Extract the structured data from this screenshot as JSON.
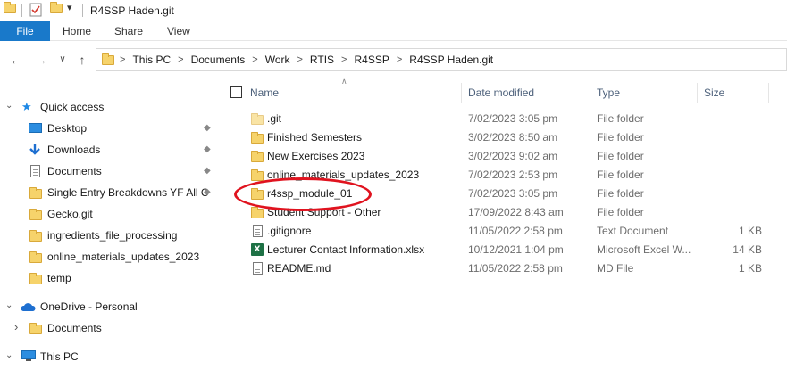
{
  "window": {
    "title": "R4SSP Haden.git"
  },
  "ribbon": {
    "tabs": [
      "File",
      "Home",
      "Share",
      "View"
    ]
  },
  "address": {
    "crumbs": [
      "This PC",
      "Documents",
      "Work",
      "RTIS",
      "R4SSP",
      "R4SSP Haden.git"
    ],
    "separator": ">"
  },
  "nav_glyphs": {
    "back": "←",
    "forward": "→",
    "recent": "∨",
    "up": "↑",
    "expand": "⌄",
    "collapsed": "›",
    "pin": "📌"
  },
  "sidebar": {
    "quick_access": "Quick access",
    "items": [
      {
        "label": "Desktop",
        "icon": "desktop-icon",
        "pinned": true
      },
      {
        "label": "Downloads",
        "icon": "downloads-icon",
        "pinned": true
      },
      {
        "label": "Documents",
        "icon": "documents-icon",
        "pinned": true
      },
      {
        "label": "Single Entry Breakdowns YF All C",
        "icon": "folder-icon",
        "pinned": true
      },
      {
        "label": "Gecko.git",
        "icon": "folder-icon",
        "pinned": false
      },
      {
        "label": "ingredients_file_processing",
        "icon": "folder-icon",
        "pinned": false
      },
      {
        "label": "online_materials_updates_2023",
        "icon": "folder-icon",
        "pinned": false
      },
      {
        "label": "temp",
        "icon": "folder-icon",
        "pinned": false
      }
    ],
    "onedrive": "OneDrive - Personal",
    "onedrive_documents": "Documents",
    "this_pc": "This PC"
  },
  "columns": {
    "name": "Name",
    "date": "Date modified",
    "type": "Type",
    "size": "Size"
  },
  "files": [
    {
      "name": ".git",
      "date": "7/02/2023 3:05 pm",
      "type": "File folder",
      "size": "",
      "icon": "folder-icon"
    },
    {
      "name": "Finished Semesters",
      "date": "3/02/2023 8:50 am",
      "type": "File folder",
      "size": "",
      "icon": "folder-icon"
    },
    {
      "name": "New Exercises 2023",
      "date": "3/02/2023 9:02 am",
      "type": "File folder",
      "size": "",
      "icon": "folder-icon"
    },
    {
      "name": "online_materials_updates_2023",
      "date": "7/02/2023 2:53 pm",
      "type": "File folder",
      "size": "",
      "icon": "folder-icon"
    },
    {
      "name": "r4ssp_module_01",
      "date": "7/02/2023 3:05 pm",
      "type": "File folder",
      "size": "",
      "icon": "folder-icon"
    },
    {
      "name": "Student Support - Other",
      "date": "17/09/2022 8:43 am",
      "type": "File folder",
      "size": "",
      "icon": "folder-icon"
    },
    {
      "name": ".gitignore",
      "date": "11/05/2022 2:58 pm",
      "type": "Text Document",
      "size": "1 KB",
      "icon": "text-file-icon"
    },
    {
      "name": "Lecturer Contact Information.xlsx",
      "date": "10/12/2021 1:04 pm",
      "type": "Microsoft Excel W...",
      "size": "14 KB",
      "icon": "excel-file-icon"
    },
    {
      "name": "README.md",
      "date": "11/05/2022 2:58 pm",
      "type": "MD File",
      "size": "1 KB",
      "icon": "md-file-icon"
    }
  ],
  "colors": {
    "accent": "#1979ca",
    "highlight_circle": "#e0131f",
    "folder": "#f6d36b"
  }
}
